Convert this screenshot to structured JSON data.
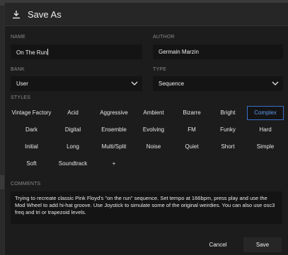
{
  "window": {
    "title": "Save As",
    "icon": "save-download-icon"
  },
  "fields": {
    "name": {
      "label": "NAME",
      "value": "On The Run"
    },
    "author": {
      "label": "AUTHOR",
      "value": "Germain Marzin"
    },
    "bank": {
      "label": "BANK",
      "value": "User"
    },
    "type": {
      "label": "TYPE",
      "value": "Sequence"
    }
  },
  "styles": {
    "label": "STYLES",
    "items": [
      {
        "label": "Vintage Factory"
      },
      {
        "label": "Acid"
      },
      {
        "label": "Aggressive"
      },
      {
        "label": "Ambient"
      },
      {
        "label": "Bizarre"
      },
      {
        "label": "Bright"
      },
      {
        "label": "Complex",
        "selected": true
      },
      {
        "label": "Dark"
      },
      {
        "label": "Digital"
      },
      {
        "label": "Ensemble"
      },
      {
        "label": "Evolving"
      },
      {
        "label": "FM"
      },
      {
        "label": "Funky"
      },
      {
        "label": "Hard"
      },
      {
        "label": "Initial"
      },
      {
        "label": "Long"
      },
      {
        "label": "Multi/Split"
      },
      {
        "label": "Noise"
      },
      {
        "label": "Quiet"
      },
      {
        "label": "Short"
      },
      {
        "label": "Simple"
      },
      {
        "label": "Soft"
      },
      {
        "label": "Soundtrack"
      },
      {
        "label": "+"
      }
    ]
  },
  "comments": {
    "label": "COMMENTS",
    "text": "Trying to recreate classic Pink Floyd's \"on the run\" sequence. Set tempo at 166bpm, press play and use the Mod Wheel to add hi-hat groove. Use Joystick to simulate some of the original weirdies. You can also use osc3 freq and tri or trapezoid levels."
  },
  "buttons": {
    "cancel": "Cancel",
    "save": "Save"
  },
  "colors": {
    "accent": "#3b6ec9",
    "accent_text": "#5e9af0",
    "background": "#1c1c1c",
    "field": "#141414"
  }
}
